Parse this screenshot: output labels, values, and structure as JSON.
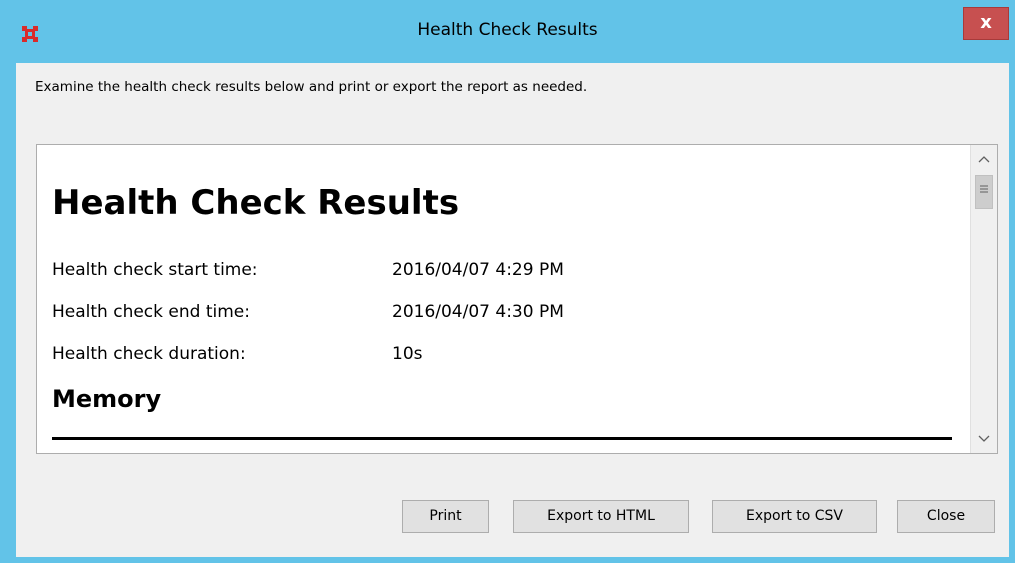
{
  "window": {
    "title": "Health Check Results",
    "close_glyph": "x",
    "icon": "app-logo-icon"
  },
  "instructions": "Examine the health check results below and print or export the report as needed.",
  "report": {
    "heading": "Health Check Results",
    "rows": [
      {
        "label": "Health check start time:",
        "value": "2016/04/07 4:29 PM"
      },
      {
        "label": "Health check end time:",
        "value": "2016/04/07 4:30 PM"
      },
      {
        "label": "Health check duration:",
        "value": "10s"
      }
    ],
    "section_heading": "Memory"
  },
  "buttons": {
    "print": "Print",
    "export_html": "Export to HTML",
    "export_csv": "Export to CSV",
    "close": "Close"
  },
  "colors": {
    "frame": "#62c3e8",
    "close_button": "#c75050",
    "icon": "#d92b2b"
  }
}
